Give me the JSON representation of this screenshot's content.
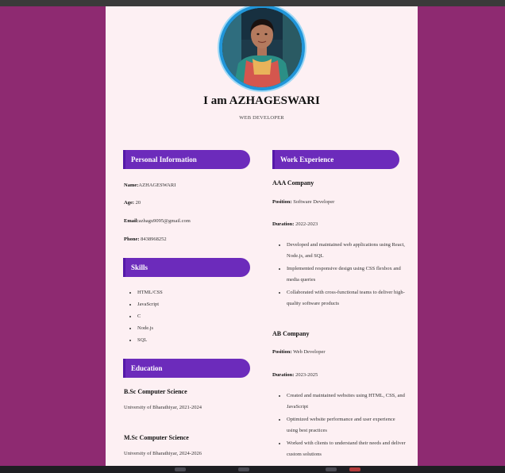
{
  "header": {
    "name": "I am AZHAGESWARI",
    "role": "WEB DEVELOPER"
  },
  "personal": {
    "title": "Personal Information",
    "name_label": "Name:",
    "name_value": "AZHAGESWARI",
    "age_label": "Age:",
    "age_value": " 20",
    "email_label": "Email:",
    "email_value": "azhagu9095@gmail.com",
    "phone_label": "Phone:",
    "phone_value": " 8438968252"
  },
  "skills": {
    "title": "Skills",
    "items": [
      "HTML/CSS",
      "JavaScript",
      "C",
      "Node.js",
      "SQL"
    ]
  },
  "education": {
    "title": "Education",
    "items": [
      {
        "degree": "B.Sc Computer Science",
        "school": "University of Bharathiyar, 2021-2024"
      },
      {
        "degree": "M.Sc Computer Science",
        "school": "University of Bharathiyar, 2024-2026"
      }
    ]
  },
  "work": {
    "title": "Work Experience",
    "position_label": "Position:",
    "duration_label": "Duration:",
    "jobs": [
      {
        "company": "AAA Company",
        "position": " Software Developer",
        "duration": " 2022-2023",
        "bullets": [
          "Developed and maintained web applications using React, Node.js, and SQL",
          "Implemented responsive design using CSS flexbox and media queries",
          "Collaborated with cross-functional teams to deliver high-quality software products"
        ]
      },
      {
        "company": "AB Company",
        "position": " Web Developer",
        "duration": " 2023-2025",
        "bullets": [
          "Created and maintained websites using HTML, CSS, and JavaScript",
          "Optimized website performance and user experience using best practices",
          "Worked with clients to understand their needs and deliver custom solutions"
        ]
      }
    ]
  },
  "colors": {
    "background": "#8e2a71",
    "page": "#fdf0f3",
    "accent": "#6c2bbb",
    "avatar_ring": "#2196d9"
  }
}
